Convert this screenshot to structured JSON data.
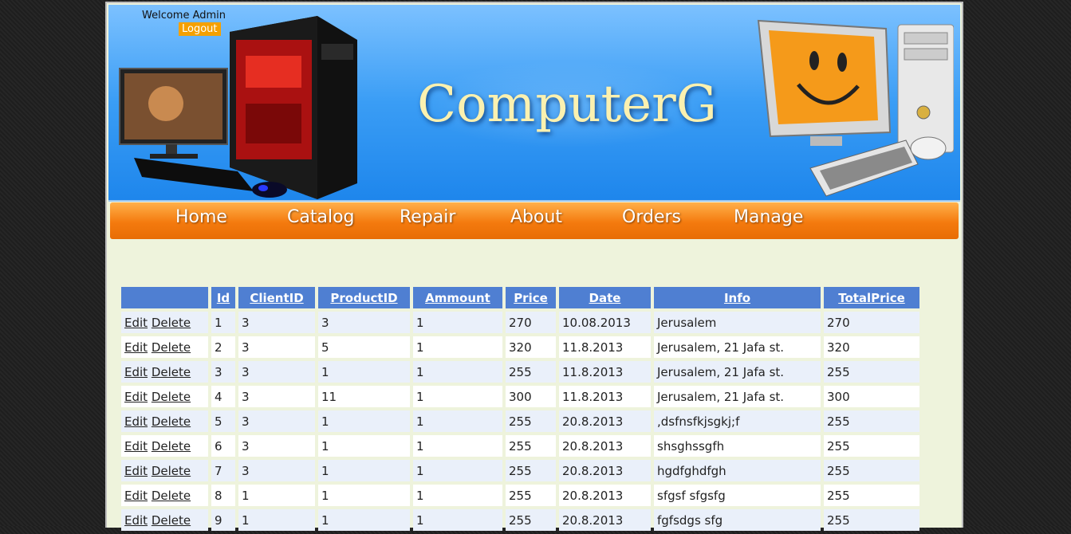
{
  "header": {
    "welcome": "Welcome Admin",
    "logout": "Logout",
    "logo": "ComputerG"
  },
  "nav": {
    "items": [
      "Home",
      "Catalog",
      "Repair",
      "About",
      "Orders",
      "Manage"
    ]
  },
  "table": {
    "columns": [
      "",
      "Id",
      "ClientID",
      "ProductID",
      "Ammount",
      "Price",
      "Date",
      "Info",
      "TotalPrice"
    ],
    "edit_label": "Edit",
    "delete_label": "Delete",
    "rows": [
      [
        "1",
        "3",
        "3",
        "1",
        "270",
        "10.08.2013",
        "Jerusalem",
        "270"
      ],
      [
        "2",
        "3",
        "5",
        "1",
        "320",
        "11.8.2013",
        "Jerusalem, 21 Jafa st.",
        "320"
      ],
      [
        "3",
        "3",
        "1",
        "1",
        "255",
        "11.8.2013",
        "Jerusalem, 21 Jafa st.",
        "255"
      ],
      [
        "4",
        "3",
        "11",
        "1",
        "300",
        "11.8.2013",
        "Jerusalem, 21 Jafa st.",
        "300"
      ],
      [
        "5",
        "3",
        "1",
        "1",
        "255",
        "20.8.2013",
        ",dsfnsfkjsgkj;f",
        "255"
      ],
      [
        "6",
        "3",
        "1",
        "1",
        "255",
        "20.8.2013",
        "shsghssgfh",
        "255"
      ],
      [
        "7",
        "3",
        "1",
        "1",
        "255",
        "20.8.2013",
        "hgdfghdfgh",
        "255"
      ],
      [
        "8",
        "1",
        "1",
        "1",
        "255",
        "20.8.2013",
        "sfgsf sfgsfg",
        "255"
      ],
      [
        "9",
        "1",
        "1",
        "1",
        "255",
        "20.8.2013",
        "fgfsdgs sfg",
        "255"
      ]
    ]
  }
}
